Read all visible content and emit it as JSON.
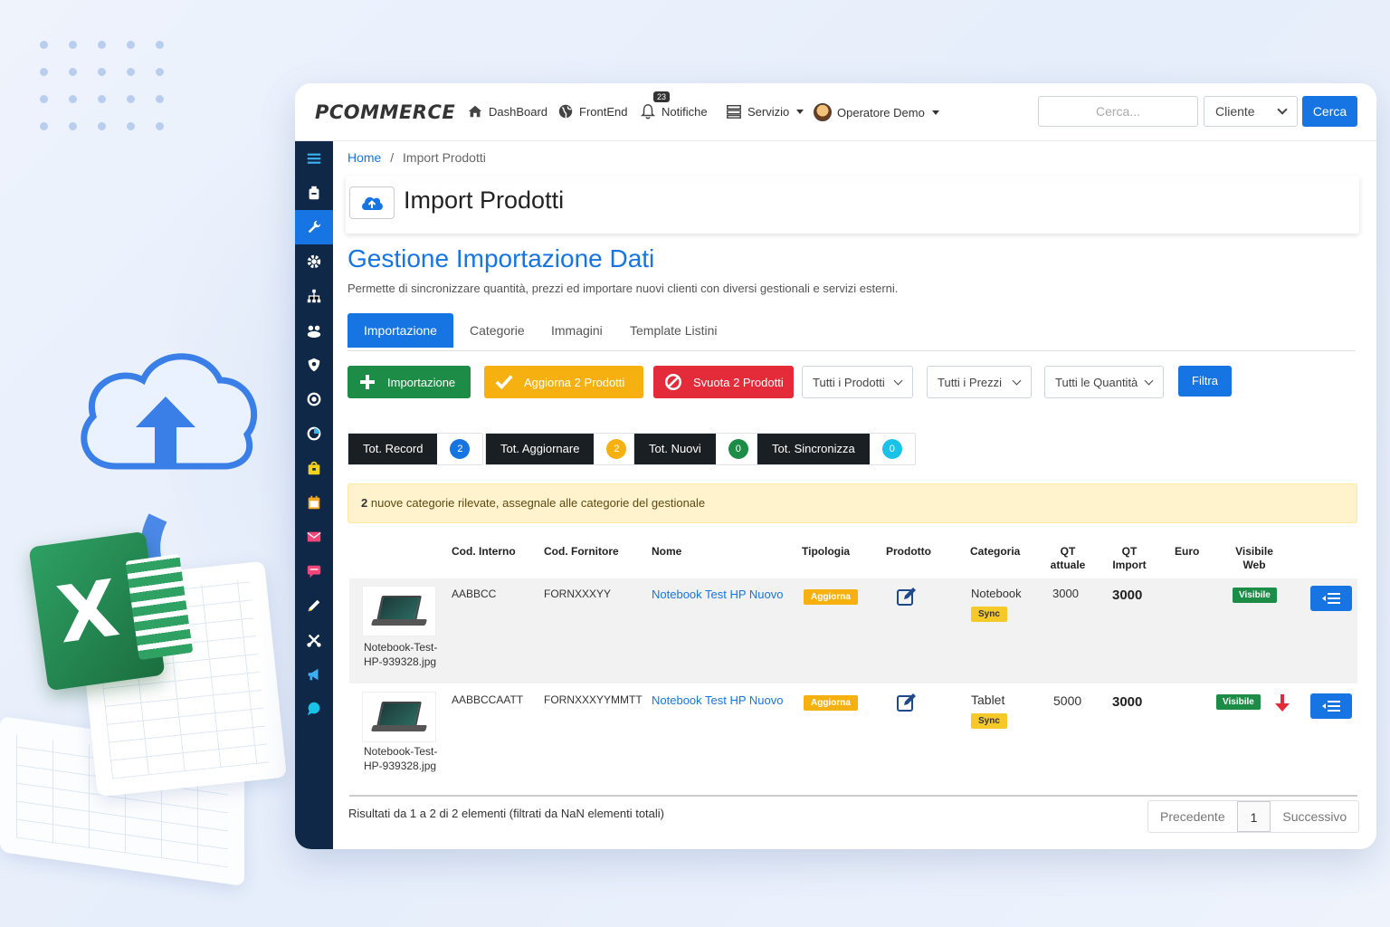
{
  "app": {
    "brand": "PCOMMERCE"
  },
  "topnav": {
    "dashboard": "DashBoard",
    "frontend": "FrontEnd",
    "notifiche": "Notifiche",
    "notifiche_count": "23",
    "servizio": "Servizio",
    "operatore": "Operatore Demo",
    "search_placeholder": "Cerca...",
    "client_select": "Cliente",
    "search_button": "Cerca"
  },
  "sidebar": {
    "icons": [
      "menu-icon",
      "inventory-icon",
      "wrench-icon",
      "gear-icon",
      "sitemap-icon",
      "users-icon",
      "shield-icon",
      "target-icon",
      "chart-icon",
      "bag-icon",
      "calendar-icon",
      "mail-icon",
      "chat-icon",
      "pencil-icon",
      "tools-icon",
      "megaphone-icon",
      "bubble-icon"
    ],
    "active_index": 2,
    "accent": "#1675e3",
    "background": "#0f2847"
  },
  "breadcrumb": {
    "home": "Home",
    "separator": "/",
    "current": "Import Prodotti"
  },
  "page": {
    "title": "Import Prodotti",
    "section_title": "Gestione Importazione Dati",
    "section_desc": "Permette di sincronizzare quantità, prezzi ed importare nuovi clienti con diversi gestionali e servizi esterni."
  },
  "tabs": [
    "Importazione",
    "Categorie",
    "Immagini",
    "Template Listini"
  ],
  "actions": {
    "import": "Importazione",
    "update": "Aggiorna 2 Prodotti",
    "clear": "Svuota 2 Prodotti",
    "filter_products": "Tutti i Prodotti",
    "filter_prices": "Tutti i Prezzi",
    "filter_quantities": "Tutti le Quantità",
    "filter_button": "Filtra"
  },
  "counters": [
    {
      "label": "Tot. Record",
      "value": "2",
      "color": "#1675e3"
    },
    {
      "label": "Tot. Aggiornare",
      "value": "2",
      "color": "#f6b111"
    },
    {
      "label": "Tot. Nuovi",
      "value": "0",
      "color": "#1c8c47"
    },
    {
      "label": "Tot. Sincronizza",
      "value": "0",
      "color": "#19c2e6"
    }
  ],
  "alert": {
    "count": "2",
    "text": "nuove categorie rilevate, assegnale alle categorie del gestionale"
  },
  "table": {
    "headers": {
      "cod_interno": "Cod. Interno",
      "cod_fornitore": "Cod. Fornitore",
      "nome": "Nome",
      "tipologia": "Tipologia",
      "prodotto": "Prodotto",
      "categoria": "Categoria",
      "qt_attuale_1": "QT",
      "qt_attuale_2": "attuale",
      "qt_import_1": "QT",
      "qt_import_2": "Import",
      "euro": "Euro",
      "visibile_1": "Visibile",
      "visibile_2": "Web"
    },
    "rows": [
      {
        "image_name_1": "Notebook-Test-",
        "image_name_2": "HP-939328.jpg",
        "cod_interno": "AABBCC",
        "cod_fornitore": "FORNXXXYY",
        "nome": "Notebook Test HP Nuovo",
        "tipologia": "Aggiorna",
        "categoria": "Notebook",
        "categoria_badge": "Sync",
        "qt_attuale": "3000",
        "qt_import": "3000",
        "visibile": "Visibile"
      },
      {
        "image_name_1": "Notebook-Test-",
        "image_name_2": "HP-939328.jpg",
        "cod_interno": "AABBCCAATT",
        "cod_fornitore": "FORNXXXYYMMTT",
        "nome": "Notebook Test HP Nuovo",
        "tipologia": "Aggiorna",
        "categoria": "Tablet",
        "categoria_badge": "Sync",
        "qt_attuale": "5000",
        "qt_import": "3000",
        "visibile": "Visibile"
      }
    ]
  },
  "footer": {
    "results": "Risultati da 1 a 2 di 2 elementi (filtrati da NaN elementi totali)",
    "prev": "Precedente",
    "page": "1",
    "next": "Successivo"
  }
}
